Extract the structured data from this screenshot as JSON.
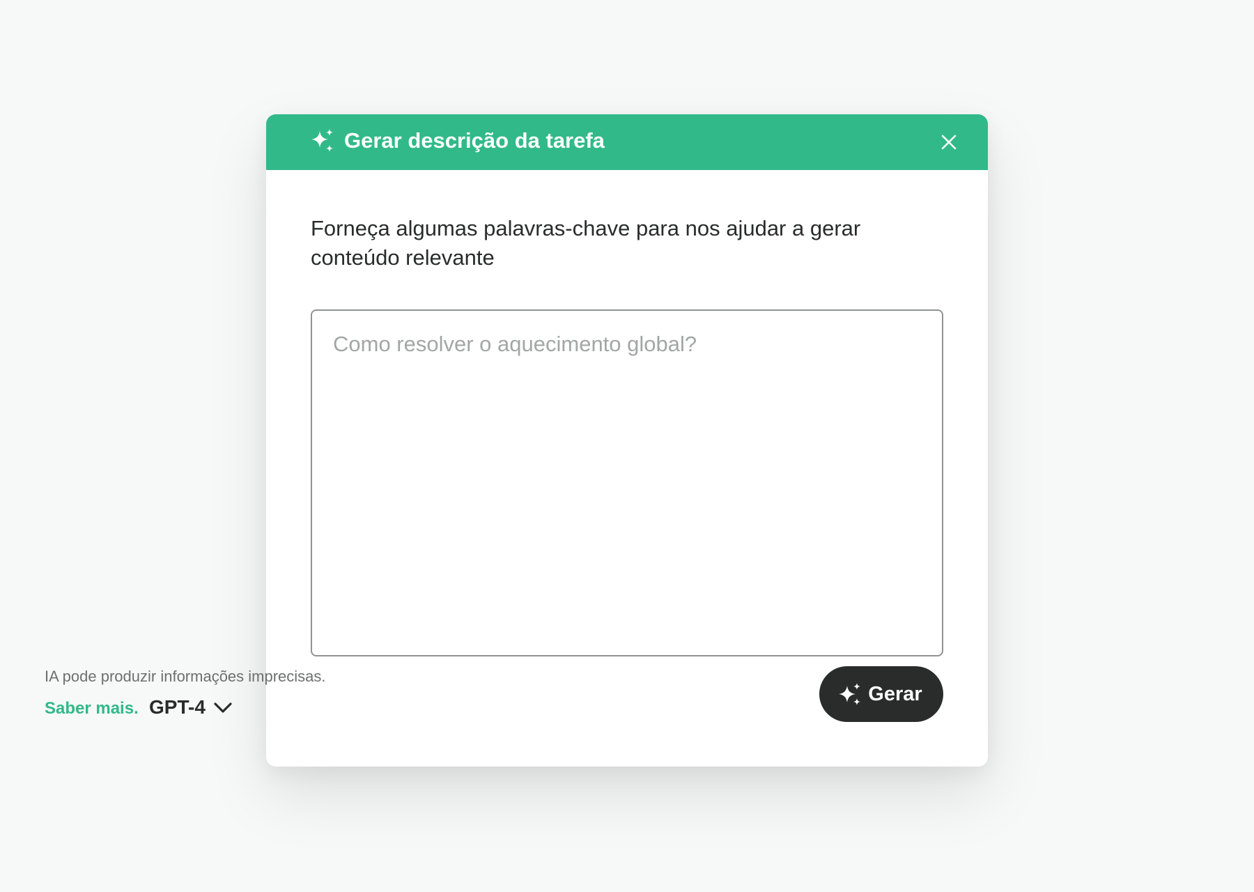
{
  "modal": {
    "title": "Gerar descrição da tarefa",
    "title_icon": "sparkles-icon",
    "close_icon": "close-icon",
    "prompt": "Forneça algumas palavras-chave para nos ajudar a gerar conteúdo relevante",
    "keywords_input": {
      "value": "",
      "placeholder": "Como resolver o aquecimento global?"
    },
    "disclaimer": "IA pode produzir informações imprecisas.",
    "learn_more": "Saber mais.",
    "model": {
      "selected": "GPT-4",
      "icon": "chevron-down-icon"
    },
    "generate_button": {
      "label": "Gerar",
      "icon": "sparkles-icon"
    }
  },
  "colors": {
    "accent": "#31b98a",
    "button_dark": "#2a2c2b",
    "background": "#f7f8f8"
  }
}
